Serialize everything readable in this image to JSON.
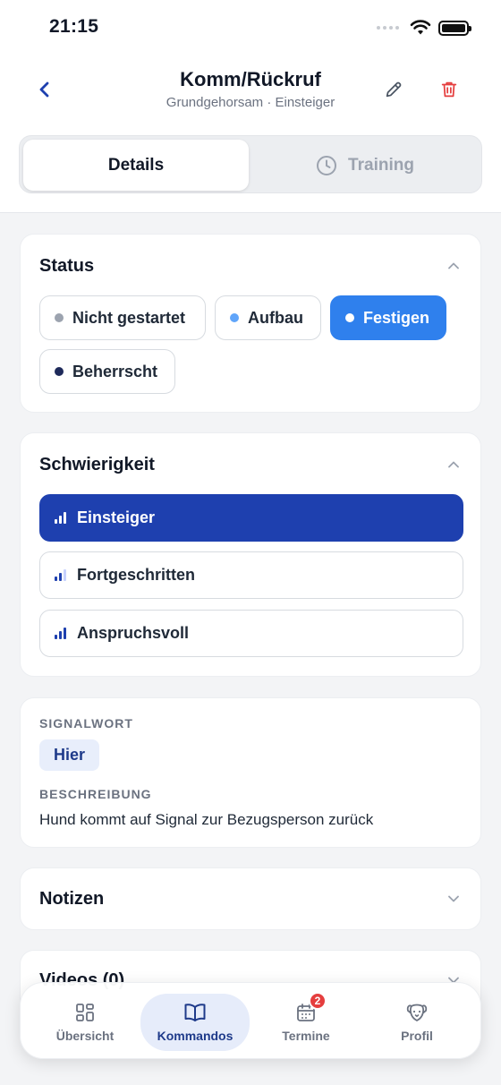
{
  "statusbar": {
    "time": "21:15"
  },
  "header": {
    "title": "Komm/Rückruf",
    "subtitle": "Grundgehorsam · Einsteiger"
  },
  "segmented": {
    "details_label": "Details",
    "training_label": "Training"
  },
  "status": {
    "title": "Status",
    "options": [
      {
        "label": "Nicht gestartet",
        "dot_color": "#9ca3af",
        "selected": false
      },
      {
        "label": "Aufbau",
        "dot_color": "#60a5fa",
        "selected": false
      },
      {
        "label": "Festigen",
        "dot_color": "#ffffff",
        "selected": true
      },
      {
        "label": "Beherrscht",
        "dot_color": "#1e2a5a",
        "selected": false
      }
    ]
  },
  "difficulty": {
    "title": "Schwierigkeit",
    "options": [
      {
        "label": "Einsteiger",
        "level": 1,
        "selected": true
      },
      {
        "label": "Fortgeschritten",
        "level": 2,
        "selected": false
      },
      {
        "label": "Anspruchsvoll",
        "level": 3,
        "selected": false
      }
    ]
  },
  "info": {
    "signal_label": "SIGNALWORT",
    "signal_value": "Hier",
    "description_label": "BESCHREIBUNG",
    "description_value": "Hund kommt auf Signal zur Bezugsperson zurück"
  },
  "notes": {
    "title": "Notizen"
  },
  "videos": {
    "title": "Videos (0)"
  },
  "tabbar": {
    "items": [
      {
        "label": "Übersicht",
        "icon": "grid-icon"
      },
      {
        "label": "Kommandos",
        "icon": "book-icon"
      },
      {
        "label": "Termine",
        "icon": "calendar-icon",
        "badge": "2"
      },
      {
        "label": "Profil",
        "icon": "dog-icon"
      }
    ]
  },
  "colors": {
    "accent": "#1e40af",
    "status_selected": "#2f80ed",
    "danger": "#e53e3e"
  }
}
